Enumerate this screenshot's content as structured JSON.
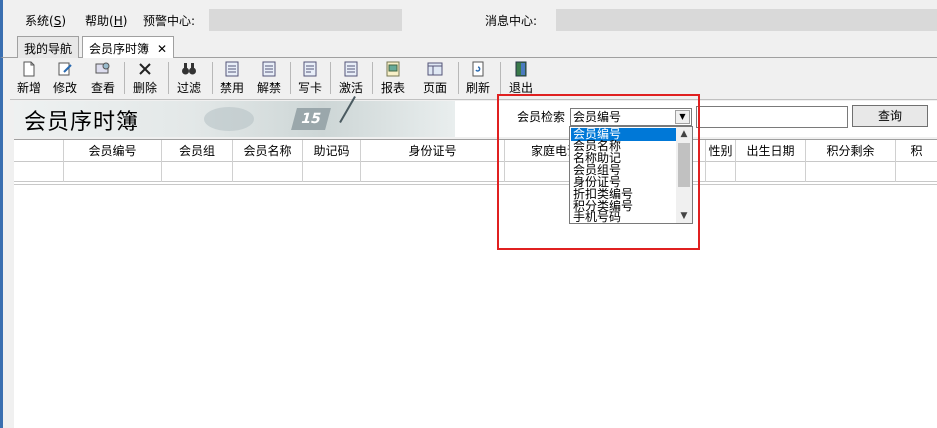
{
  "menu": {
    "system": "系统(S)",
    "system_key": "S",
    "help": "帮助(H)",
    "alert_center": "预警中心:",
    "message_center": "消息中心:"
  },
  "tabs": [
    {
      "label": "我的导航"
    },
    {
      "label": "会员序时簿",
      "close": "✕"
    }
  ],
  "toolbar": {
    "add": "新增",
    "edit": "修改",
    "view": "查看",
    "delete": "删除",
    "filter": "过滤",
    "disable": "禁用",
    "unban": "解禁",
    "write_card": "写卡",
    "activate": "激活",
    "report": "报表",
    "page": "页面",
    "refresh": "刷新",
    "exit": "退出"
  },
  "banner": {
    "title": "会员序时簿",
    "deco_number": "15"
  },
  "search": {
    "label": "会员检索",
    "selected": "会员编号",
    "button": "查询",
    "options": [
      "会员编号",
      "会员名称",
      "名称助记",
      "会员组号",
      "身份证号",
      "折扣类编号",
      "积分类编号",
      "手机号码"
    ]
  },
  "grid": {
    "columns": [
      "会员编号",
      "会员组",
      "会员名称",
      "助记码",
      "身份证号",
      "家庭电话",
      "性别",
      "出生日期",
      "积分剩余",
      "积"
    ]
  },
  "colors": {
    "accent": "#0078d7",
    "highlight": "#e02020",
    "left_edge": "#3a6fb0"
  },
  "icons": [
    "new-doc-icon",
    "edit-icon",
    "view-icon",
    "delete-icon",
    "binoculars-icon",
    "list-icon",
    "list-icon",
    "card-icon",
    "list-icon",
    "report-icon",
    "page-icon",
    "refresh-icon",
    "exit-door-icon"
  ]
}
